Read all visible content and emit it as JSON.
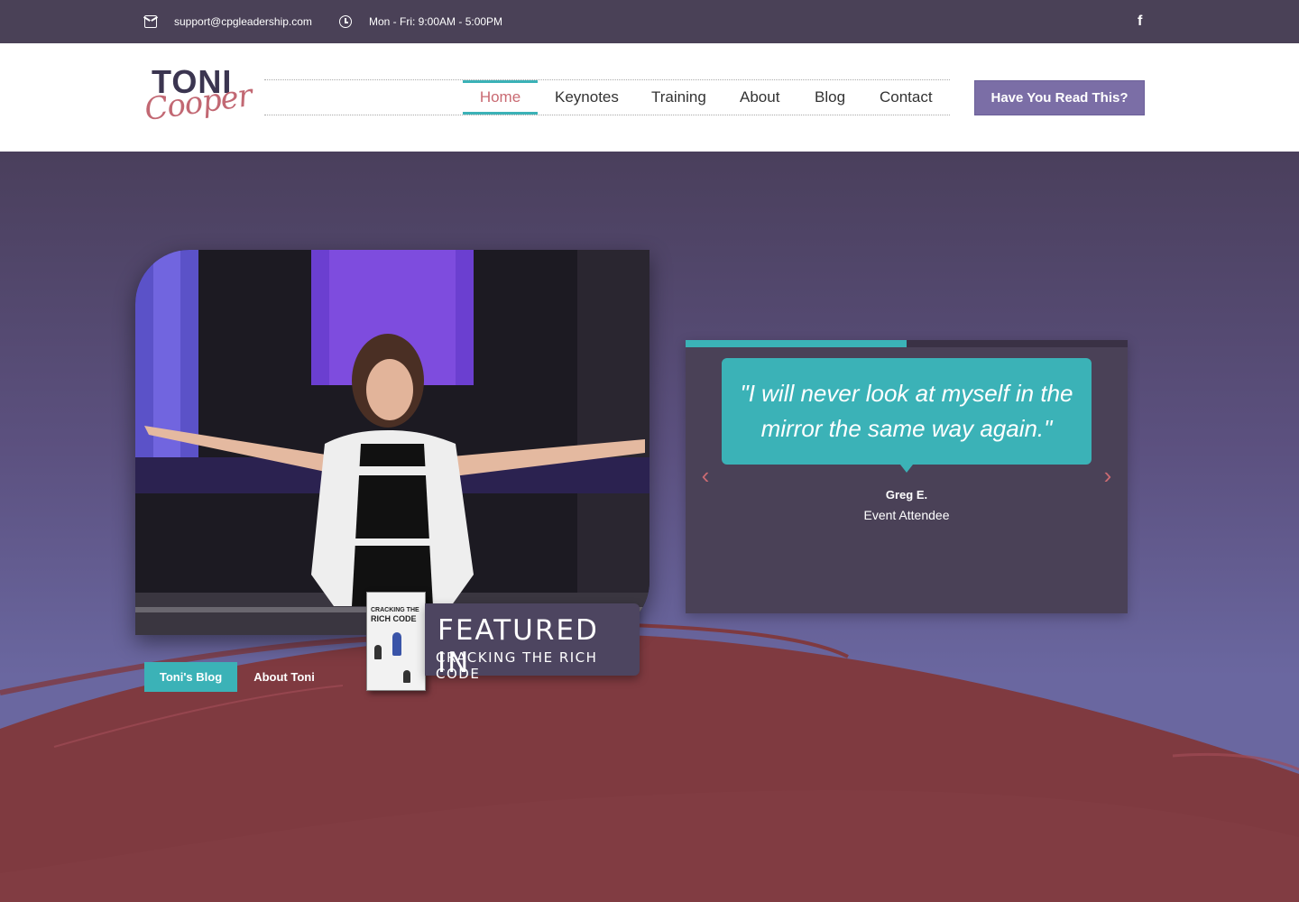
{
  "topbar": {
    "email": "support@cpgleadership.com",
    "hours": "Mon - Fri: 9:00AM - 5:00PM",
    "email_icon": "envelope-icon",
    "clock_icon": "clock-icon",
    "social_icon": "facebook-icon",
    "social_glyph": "f"
  },
  "header": {
    "logo_line1": "TONI",
    "logo_line2": "Cooper",
    "nav": [
      {
        "label": "Home",
        "active": true
      },
      {
        "label": "Keynotes",
        "active": false
      },
      {
        "label": "Training",
        "active": false
      },
      {
        "label": "About",
        "active": false
      },
      {
        "label": "Blog",
        "active": false
      },
      {
        "label": "Contact",
        "active": false
      }
    ],
    "cta_label": "Have You Read This?"
  },
  "hero": {
    "featured_title": "FEATURED IN",
    "featured_subtitle": "CRACKING THE RICH CODE",
    "book_line1": "CRACKING THE",
    "book_line2": "RICH CODE",
    "blog_button": "Toni's Blog",
    "about_button": "About Toni"
  },
  "testimonial": {
    "quote": "\"I will never look at myself in the mirror the same way again.\"",
    "name": "Greg E.",
    "role": "Event Attendee",
    "progress": 0.5,
    "prev_glyph": "‹",
    "next_glyph": "›"
  },
  "colors": {
    "accent": "#3bb2b7",
    "brand_purple": "#7b6ea6",
    "nav_active": "#c96a72",
    "dark": "#4a4157",
    "wave": "#7f3a40"
  }
}
